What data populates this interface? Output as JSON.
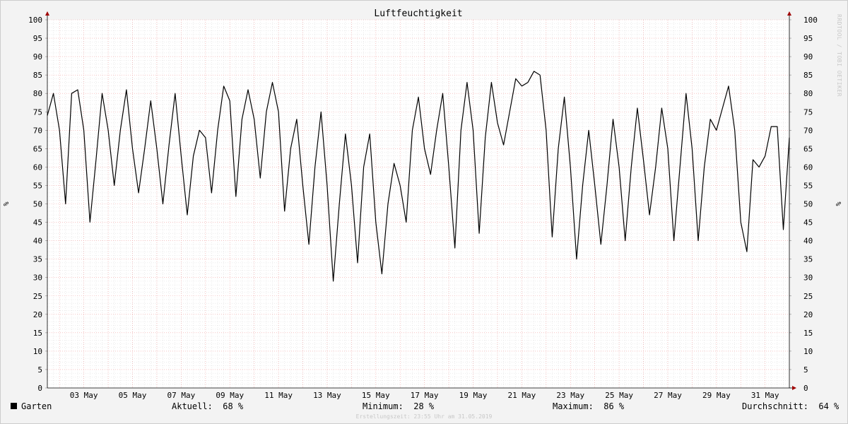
{
  "chart_data": {
    "type": "line",
    "title": "Luftfeuchtigkeit",
    "ylabel": "%",
    "ylabel_right": "%",
    "ylim": [
      0,
      100
    ],
    "yticks": [
      0,
      5,
      10,
      15,
      20,
      25,
      30,
      35,
      40,
      45,
      50,
      55,
      60,
      65,
      70,
      75,
      80,
      85,
      90,
      95,
      100
    ],
    "xlim": [
      "2019-05-01 12:00",
      "2019-05-31 23:55"
    ],
    "xticks": [
      {
        "label": "03 May",
        "t": "2019-05-03"
      },
      {
        "label": "05 May",
        "t": "2019-05-05"
      },
      {
        "label": "07 May",
        "t": "2019-05-07"
      },
      {
        "label": "09 May",
        "t": "2019-05-09"
      },
      {
        "label": "11 May",
        "t": "2019-05-11"
      },
      {
        "label": "13 May",
        "t": "2019-05-13"
      },
      {
        "label": "15 May",
        "t": "2019-05-15"
      },
      {
        "label": "17 May",
        "t": "2019-05-17"
      },
      {
        "label": "19 May",
        "t": "2019-05-19"
      },
      {
        "label": "21 May",
        "t": "2019-05-21"
      },
      {
        "label": "23 May",
        "t": "2019-05-23"
      },
      {
        "label": "25 May",
        "t": "2019-05-25"
      },
      {
        "label": "27 May",
        "t": "2019-05-27"
      },
      {
        "label": "29 May",
        "t": "2019-05-29"
      },
      {
        "label": "31 May",
        "t": "2019-05-31"
      }
    ],
    "grid": true,
    "series": [
      {
        "name": "Garten",
        "color": "#000000",
        "points": [
          [
            "2019-05-01 12:00",
            74
          ],
          [
            "2019-05-01 18:00",
            80
          ],
          [
            "2019-05-02 00:00",
            70
          ],
          [
            "2019-05-02 06:00",
            50
          ],
          [
            "2019-05-02 12:00",
            80
          ],
          [
            "2019-05-02 18:00",
            81
          ],
          [
            "2019-05-03 00:00",
            70
          ],
          [
            "2019-05-03 06:00",
            45
          ],
          [
            "2019-05-03 12:00",
            62
          ],
          [
            "2019-05-03 18:00",
            80
          ],
          [
            "2019-05-04 00:00",
            70
          ],
          [
            "2019-05-04 06:00",
            55
          ],
          [
            "2019-05-04 12:00",
            70
          ],
          [
            "2019-05-04 18:00",
            81
          ],
          [
            "2019-05-05 00:00",
            65
          ],
          [
            "2019-05-05 06:00",
            53
          ],
          [
            "2019-05-05 12:00",
            65
          ],
          [
            "2019-05-05 18:00",
            78
          ],
          [
            "2019-05-06 00:00",
            65
          ],
          [
            "2019-05-06 06:00",
            50
          ],
          [
            "2019-05-06 12:00",
            66
          ],
          [
            "2019-05-06 18:00",
            80
          ],
          [
            "2019-05-07 00:00",
            63
          ],
          [
            "2019-05-07 06:00",
            47
          ],
          [
            "2019-05-07 12:00",
            63
          ],
          [
            "2019-05-07 18:00",
            70
          ],
          [
            "2019-05-08 00:00",
            68
          ],
          [
            "2019-05-08 06:00",
            53
          ],
          [
            "2019-05-08 12:00",
            70
          ],
          [
            "2019-05-08 18:00",
            82
          ],
          [
            "2019-05-09 00:00",
            78
          ],
          [
            "2019-05-09 06:00",
            52
          ],
          [
            "2019-05-09 12:00",
            73
          ],
          [
            "2019-05-09 18:00",
            81
          ],
          [
            "2019-05-10 00:00",
            73
          ],
          [
            "2019-05-10 06:00",
            57
          ],
          [
            "2019-05-10 12:00",
            75
          ],
          [
            "2019-05-10 18:00",
            83
          ],
          [
            "2019-05-11 00:00",
            75
          ],
          [
            "2019-05-11 06:00",
            48
          ],
          [
            "2019-05-11 12:00",
            65
          ],
          [
            "2019-05-11 18:00",
            73
          ],
          [
            "2019-05-12 00:00",
            55
          ],
          [
            "2019-05-12 06:00",
            39
          ],
          [
            "2019-05-12 12:00",
            60
          ],
          [
            "2019-05-12 18:00",
            75
          ],
          [
            "2019-05-13 00:00",
            55
          ],
          [
            "2019-05-13 06:00",
            29
          ],
          [
            "2019-05-13 12:00",
            50
          ],
          [
            "2019-05-13 18:00",
            69
          ],
          [
            "2019-05-14 00:00",
            55
          ],
          [
            "2019-05-14 06:00",
            34
          ],
          [
            "2019-05-14 12:00",
            60
          ],
          [
            "2019-05-14 18:00",
            69
          ],
          [
            "2019-05-15 00:00",
            45
          ],
          [
            "2019-05-15 06:00",
            31
          ],
          [
            "2019-05-15 12:00",
            50
          ],
          [
            "2019-05-15 18:00",
            61
          ],
          [
            "2019-05-16 00:00",
            55
          ],
          [
            "2019-05-16 06:00",
            45
          ],
          [
            "2019-05-16 12:00",
            70
          ],
          [
            "2019-05-16 18:00",
            79
          ],
          [
            "2019-05-17 00:00",
            65
          ],
          [
            "2019-05-17 06:00",
            58
          ],
          [
            "2019-05-17 12:00",
            70
          ],
          [
            "2019-05-17 18:00",
            80
          ],
          [
            "2019-05-18 00:00",
            60
          ],
          [
            "2019-05-18 06:00",
            38
          ],
          [
            "2019-05-18 12:00",
            70
          ],
          [
            "2019-05-18 18:00",
            83
          ],
          [
            "2019-05-19 00:00",
            70
          ],
          [
            "2019-05-19 06:00",
            42
          ],
          [
            "2019-05-19 12:00",
            68
          ],
          [
            "2019-05-19 18:00",
            83
          ],
          [
            "2019-05-20 00:00",
            72
          ],
          [
            "2019-05-20 06:00",
            66
          ],
          [
            "2019-05-20 12:00",
            75
          ],
          [
            "2019-05-20 18:00",
            84
          ],
          [
            "2019-05-21 00:00",
            82
          ],
          [
            "2019-05-21 06:00",
            83
          ],
          [
            "2019-05-21 12:00",
            86
          ],
          [
            "2019-05-21 18:00",
            85
          ],
          [
            "2019-05-22 00:00",
            70
          ],
          [
            "2019-05-22 06:00",
            41
          ],
          [
            "2019-05-22 12:00",
            65
          ],
          [
            "2019-05-22 18:00",
            79
          ],
          [
            "2019-05-23 00:00",
            60
          ],
          [
            "2019-05-23 06:00",
            35
          ],
          [
            "2019-05-23 12:00",
            55
          ],
          [
            "2019-05-23 18:00",
            70
          ],
          [
            "2019-05-24 00:00",
            55
          ],
          [
            "2019-05-24 06:00",
            39
          ],
          [
            "2019-05-24 12:00",
            55
          ],
          [
            "2019-05-24 18:00",
            73
          ],
          [
            "2019-05-25 00:00",
            60
          ],
          [
            "2019-05-25 06:00",
            40
          ],
          [
            "2019-05-25 12:00",
            60
          ],
          [
            "2019-05-25 18:00",
            76
          ],
          [
            "2019-05-26 00:00",
            62
          ],
          [
            "2019-05-26 06:00",
            47
          ],
          [
            "2019-05-26 12:00",
            60
          ],
          [
            "2019-05-26 18:00",
            76
          ],
          [
            "2019-05-27 00:00",
            65
          ],
          [
            "2019-05-27 06:00",
            40
          ],
          [
            "2019-05-27 12:00",
            60
          ],
          [
            "2019-05-27 18:00",
            80
          ],
          [
            "2019-05-28 00:00",
            65
          ],
          [
            "2019-05-28 06:00",
            40
          ],
          [
            "2019-05-28 12:00",
            60
          ],
          [
            "2019-05-28 18:00",
            73
          ],
          [
            "2019-05-29 00:00",
            70
          ],
          [
            "2019-05-29 06:00",
            76
          ],
          [
            "2019-05-29 12:00",
            82
          ],
          [
            "2019-05-29 18:00",
            70
          ],
          [
            "2019-05-30 00:00",
            45
          ],
          [
            "2019-05-30 06:00",
            37
          ],
          [
            "2019-05-30 12:00",
            62
          ],
          [
            "2019-05-30 18:00",
            60
          ],
          [
            "2019-05-31 00:00",
            63
          ],
          [
            "2019-05-31 06:00",
            71
          ],
          [
            "2019-05-31 12:00",
            71
          ],
          [
            "2019-05-31 18:00",
            43
          ],
          [
            "2019-05-31 23:55",
            68
          ]
        ]
      }
    ]
  },
  "legend": {
    "series_name": "Garten",
    "current": "Aktuell:  68 %",
    "minimum": "Minimum:  28 %",
    "maximum": "Maximum:  86 %",
    "average": "Durchschnitt:  64 %"
  },
  "footer": "Erstellungszeit: 23:55 Uhr am 31.05.2019",
  "watermark": "RRDTOOL / TOBI OETIKER"
}
